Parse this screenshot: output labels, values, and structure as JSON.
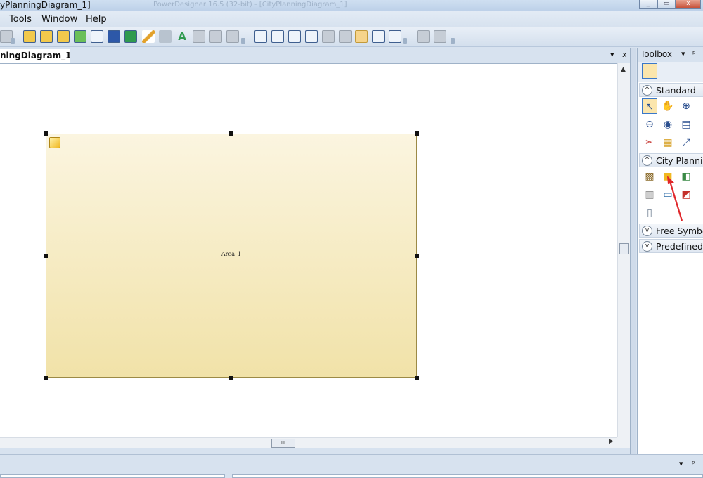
{
  "window": {
    "title": "yPlanningDiagram_1]",
    "ghost_title": "PowerDesigner 16.5 (32-bit) - [CityPlanningDiagram_1]",
    "buttons": {
      "minimize": "_",
      "restore": "▭",
      "close": "x"
    }
  },
  "menu": {
    "items": [
      {
        "label": "Tools"
      },
      {
        "label": "Window"
      },
      {
        "label": "Help"
      }
    ]
  },
  "document": {
    "tab_label": "ningDiagram_1",
    "tab_menu": "▾",
    "tab_close": "x"
  },
  "canvas": {
    "shape": {
      "label": "Area_1"
    }
  },
  "scroll": {
    "up": "▲",
    "right": "▶",
    "h_thumb": "III"
  },
  "toolbox": {
    "title": "Toolbox",
    "menu_glyph": "▾",
    "pin_glyph": "ᵖ",
    "sections": [
      {
        "label": "Standard",
        "state": "expanded",
        "chev": "^"
      },
      {
        "label": "City Planning",
        "state": "expanded",
        "chev": "^"
      },
      {
        "label": "Free Symbols",
        "state": "collapsed",
        "chev": "v"
      },
      {
        "label": "Predefined",
        "state": "collapsed",
        "chev": "v"
      }
    ]
  },
  "bottom_panel": {
    "menu_glyph": "▾",
    "pin_glyph": "ᵖ"
  },
  "colors": {
    "chrome": "#d7e2ef",
    "shape_top": "#fbf5e0",
    "shape_bottom": "#f1e2a8",
    "annotation": "#e0262a"
  }
}
